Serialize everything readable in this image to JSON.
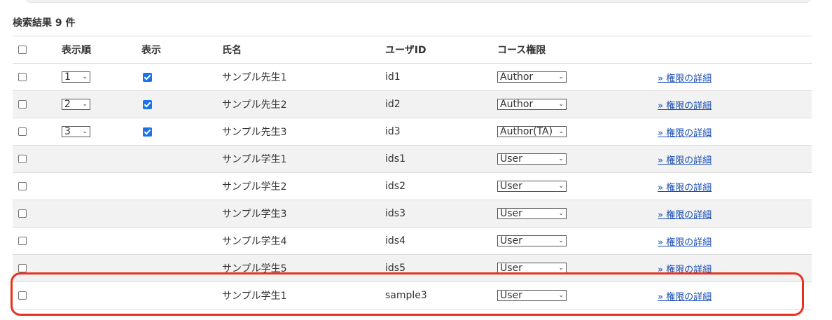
{
  "heading": "検索結果 9 件",
  "columns": {
    "order": "表示順",
    "display": "表示",
    "name": "氏名",
    "user_id": "ユーザID",
    "role": "コース権限"
  },
  "caret": "⌄",
  "rows": [
    {
      "order": "1",
      "display": true,
      "name": "サンプル先生1",
      "user_id": "id1",
      "role": "Author",
      "link": "» 権限の詳細"
    },
    {
      "order": "2",
      "display": true,
      "name": "サンプル先生2",
      "user_id": "id2",
      "role": "Author",
      "link": "» 権限の詳細"
    },
    {
      "order": "3",
      "display": true,
      "name": "サンプル先生3",
      "user_id": "id3",
      "role": "Author(TA)",
      "link": "» 権限の詳細"
    },
    {
      "order": "",
      "display": false,
      "name": "サンプル学生1",
      "user_id": "ids1",
      "role": "User",
      "link": "» 権限の詳細"
    },
    {
      "order": "",
      "display": false,
      "name": "サンプル学生2",
      "user_id": "ids2",
      "role": "User",
      "link": "» 権限の詳細"
    },
    {
      "order": "",
      "display": false,
      "name": "サンプル学生3",
      "user_id": "ids3",
      "role": "User",
      "link": "» 権限の詳細"
    },
    {
      "order": "",
      "display": false,
      "name": "サンプル学生4",
      "user_id": "ids4",
      "role": "User",
      "link": "» 権限の詳細"
    },
    {
      "order": "",
      "display": false,
      "name": "サンプル学生5",
      "user_id": "ids5",
      "role": "User",
      "link": "» 権限の詳細"
    },
    {
      "order": "",
      "display": false,
      "name": "サンプル学生1",
      "user_id": "sample3",
      "role": "User",
      "link": "» 権限の詳細"
    }
  ],
  "colors": {
    "highlight": "#e8321f",
    "checkbox_checked": "#1a73e8",
    "link": "#1a4fb4",
    "row_alt": "#f2f2f2"
  }
}
